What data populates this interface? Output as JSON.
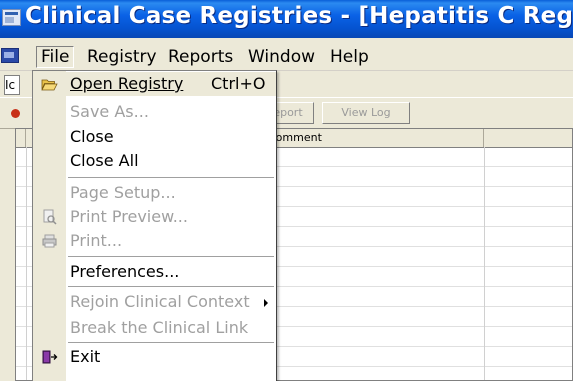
{
  "window": {
    "title": "Clinical Case Registries - [Hepatitis C Registry]"
  },
  "menubar": {
    "items": [
      {
        "label": "File",
        "active": true
      },
      {
        "label": "Registry"
      },
      {
        "label": "Reports"
      },
      {
        "label": "Window"
      },
      {
        "label": "Help"
      }
    ]
  },
  "toolbar": {
    "left_button_label": "Ic",
    "report_label": "eport",
    "view_log_label": "View Log"
  },
  "grid": {
    "column_headers": [
      "Comment"
    ]
  },
  "file_menu": {
    "items": [
      {
        "label": "Open Registry",
        "shortcut": "Ctrl+O",
        "icon": "open-folder-icon",
        "enabled": true
      },
      {
        "label": "Save As...",
        "enabled": false
      },
      {
        "label": "Close",
        "enabled": true
      },
      {
        "label": "Close All",
        "enabled": true
      },
      {
        "label": "Page Setup...",
        "enabled": false
      },
      {
        "label": "Print Preview...",
        "icon": "print-preview-icon",
        "enabled": false
      },
      {
        "label": "Print...",
        "icon": "printer-icon",
        "enabled": false
      },
      {
        "label": "Preferences...",
        "enabled": true
      },
      {
        "label": "Rejoin Clinical Context",
        "enabled": false,
        "submenu": true
      },
      {
        "label": "Break the Clinical Link",
        "enabled": false
      },
      {
        "label": "Exit",
        "icon": "exit-door-icon",
        "enabled": true
      }
    ]
  },
  "colors": {
    "titlebar": "#0553d0",
    "disabled_text": "#a0a0a0",
    "menu_bg": "#ece9d8"
  }
}
